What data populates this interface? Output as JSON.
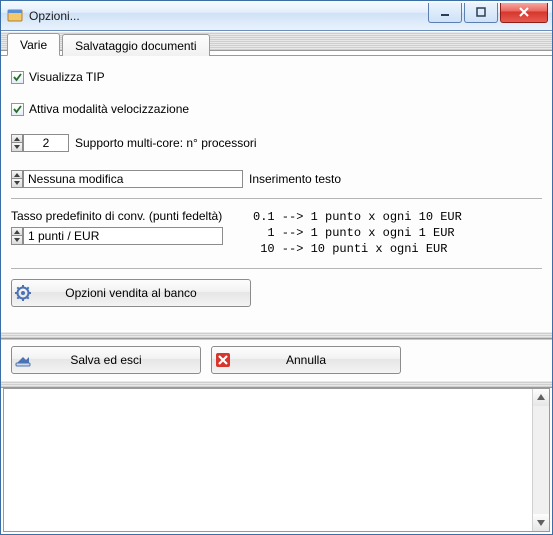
{
  "window": {
    "title": "Opzioni..."
  },
  "tabs": {
    "varie": "Varie",
    "salvataggio": "Salvataggio documenti"
  },
  "checks": {
    "visualizza_tip": "Visualizza TIP",
    "attiva_velocizzazione": "Attiva modalità velocizzazione"
  },
  "multicore": {
    "value": "2",
    "label": "Supporto multi-core: n° processori"
  },
  "inserimento": {
    "value": "Nessuna modifica",
    "label": "Inserimento testo"
  },
  "tasso": {
    "label": "Tasso predefinito di conv. (punti fedeltà)",
    "value": "1 punti / EUR",
    "help": "0.1 --> 1 punto x ogni 10 EUR\n  1 --> 1 punto x ogni 1 EUR\n 10 --> 10 punti x ogni EUR"
  },
  "buttons": {
    "opzioni_vendita": "Opzioni vendita al banco",
    "salva": "Salva ed esci",
    "annulla": "Annulla"
  }
}
